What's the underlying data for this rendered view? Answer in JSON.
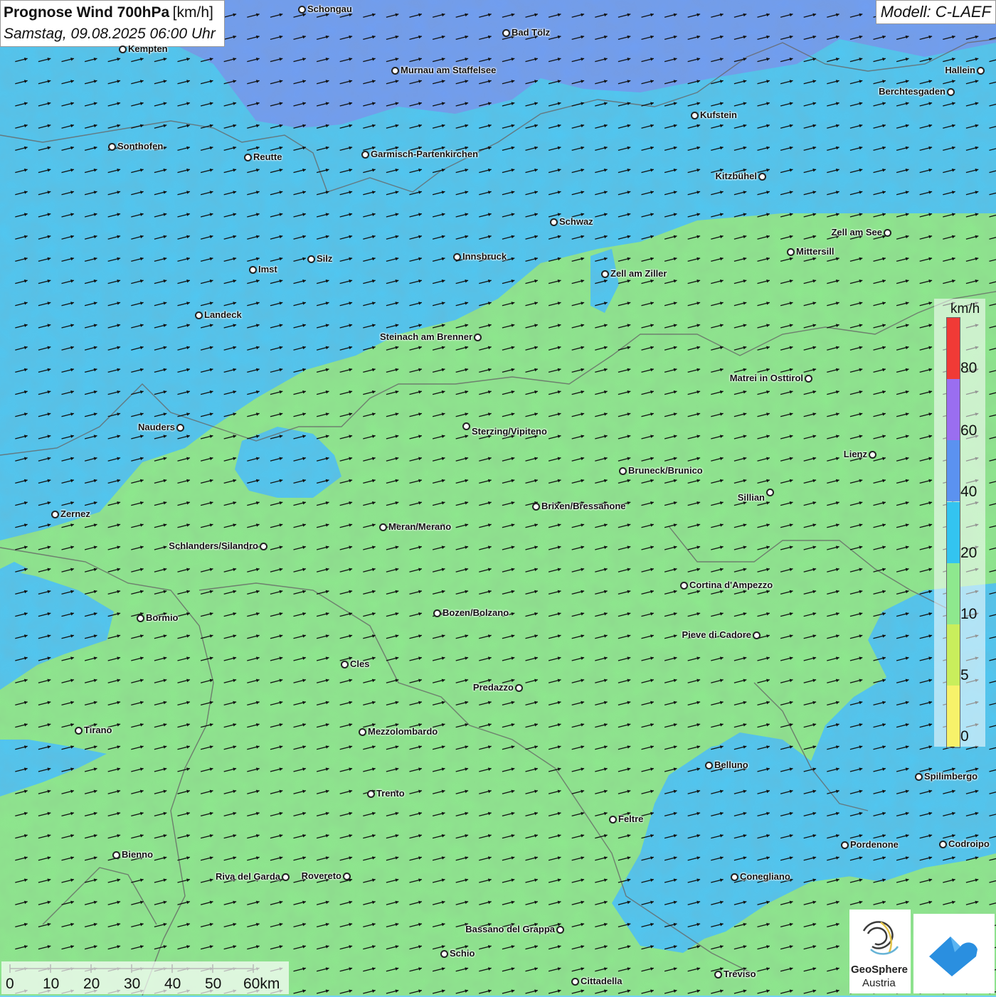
{
  "header": {
    "title": "Prognose Wind 700hPa",
    "unit": "[km/h]",
    "datetime": "Samstag, 09.08.2025 06:00 Uhr",
    "model": "Modell: C-LAEF"
  },
  "legend": {
    "unit": "km/h",
    "labels": [
      "80",
      "60",
      "40",
      "20",
      "10",
      "5",
      "0"
    ],
    "colors": [
      "#f03a36",
      "#9a6ef0",
      "#5b92f0",
      "#33c4f0",
      "#8ee88e",
      "#c9ee5c",
      "#f7f26a"
    ]
  },
  "scale_bar": {
    "labels": [
      "0",
      "10",
      "20",
      "30",
      "40",
      "50",
      "60km"
    ]
  },
  "logo": {
    "name_line1": "GeoSphere",
    "name_line2": "Austria"
  },
  "wind_direction": "east-northeast",
  "cities": [
    {
      "name": "Schongau"
    },
    {
      "name": "Bad Tölz"
    },
    {
      "name": "Kempten"
    },
    {
      "name": "Murnau am Staffelsee"
    },
    {
      "name": "Hallein"
    },
    {
      "name": "Berchtesgaden"
    },
    {
      "name": "Kufstein"
    },
    {
      "name": "Sonthofen"
    },
    {
      "name": "Reutte"
    },
    {
      "name": "Garmisch-Partenkirchen"
    },
    {
      "name": "Kitzbühel"
    },
    {
      "name": "Schwaz"
    },
    {
      "name": "Zell am See"
    },
    {
      "name": "Mittersill"
    },
    {
      "name": "Innsbruck"
    },
    {
      "name": "Silz"
    },
    {
      "name": "Imst"
    },
    {
      "name": "Zell am Ziller"
    },
    {
      "name": "Landeck"
    },
    {
      "name": "Steinach am Brenner"
    },
    {
      "name": "Matrei in Osttirol"
    },
    {
      "name": "Nauders"
    },
    {
      "name": "Sterzing/Vipiteno"
    },
    {
      "name": "Lienz"
    },
    {
      "name": "Bruneck/Brunico"
    },
    {
      "name": "Sillian"
    },
    {
      "name": "Brixen/Bressanone"
    },
    {
      "name": "Zernez"
    },
    {
      "name": "Meran/Merano"
    },
    {
      "name": "Schlanders/Silandro"
    },
    {
      "name": "Cortina d'Ampezzo"
    },
    {
      "name": "Bormio"
    },
    {
      "name": "Bozen/Bolzano"
    },
    {
      "name": "Pieve di Cadore"
    },
    {
      "name": "Cles"
    },
    {
      "name": "Predazzo"
    },
    {
      "name": "Tirano"
    },
    {
      "name": "Mezzolombardo"
    },
    {
      "name": "Belluno"
    },
    {
      "name": "Spilimbergo"
    },
    {
      "name": "Trento"
    },
    {
      "name": "Feltre"
    },
    {
      "name": "Pordenone"
    },
    {
      "name": "Codroipo"
    },
    {
      "name": "Bienno"
    },
    {
      "name": "Riva del Garda"
    },
    {
      "name": "Rovereto"
    },
    {
      "name": "Conegliano"
    },
    {
      "name": "Bassano del Grappa"
    },
    {
      "name": "Schio"
    },
    {
      "name": "Treviso"
    },
    {
      "name": "Cittadella"
    }
  ]
}
